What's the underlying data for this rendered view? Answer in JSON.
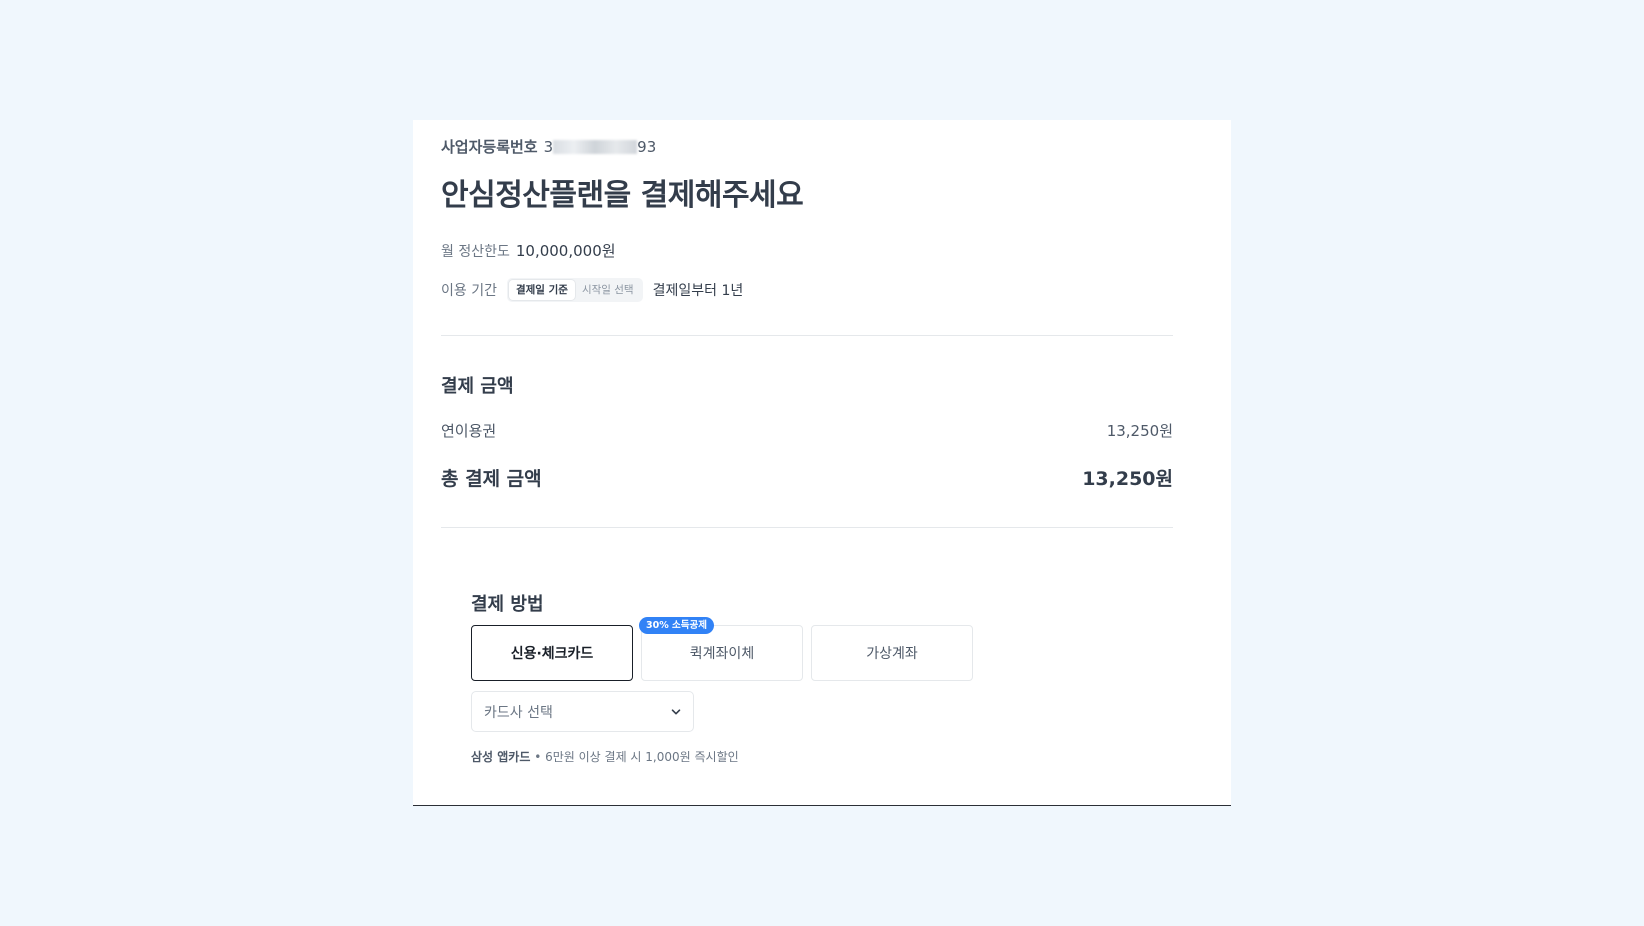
{
  "business": {
    "label": "사업자등록번호",
    "number_prefix": "3",
    "number_suffix": "93"
  },
  "title": "안심정산플랜을 결제해주세요",
  "monthly_limit": {
    "label": "월 정산한도",
    "value": "10,000,000원"
  },
  "period": {
    "label": "이용 기간",
    "options": [
      "결제일 기준",
      "시작일 선택"
    ],
    "selected_index": 0,
    "note": "결제일부터 1년"
  },
  "amount": {
    "section_title": "결제 금액",
    "item_label": "연이용권",
    "item_value": "13,250원",
    "total_label": "총 결제 금액",
    "total_value": "13,250원"
  },
  "payment": {
    "section_title": "결제 방법",
    "methods": [
      {
        "label": "신용·체크카드",
        "selected": true
      },
      {
        "label": "퀵계좌이체",
        "badge": "30% 소득공제"
      },
      {
        "label": "가상계좌"
      }
    ],
    "card_select_placeholder": "카드사 선택",
    "promo_brand": "삼성 앱카드",
    "promo_text": "• 6만원 이상 결제 시 1,000원 즉시할인"
  },
  "icons": {
    "dropdown": "chevron-down-icon"
  },
  "colors": {
    "accent": "#3182f6",
    "background": "#f0f7fd"
  }
}
